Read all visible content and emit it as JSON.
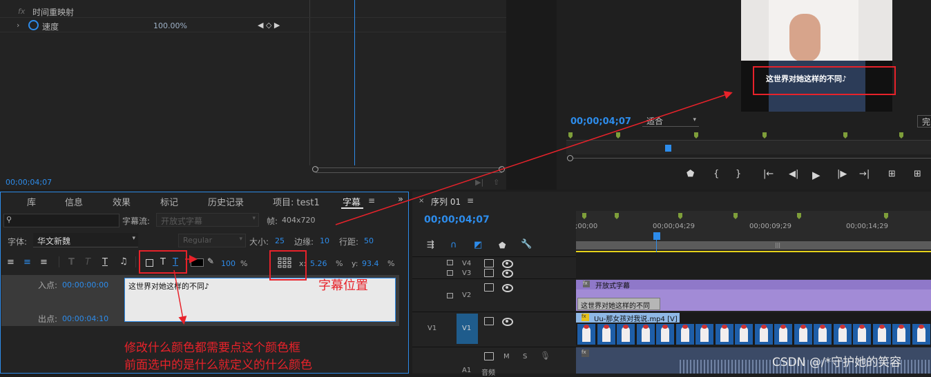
{
  "effect_controls": {
    "time_remap": "时间重映射",
    "speed_label": "速度",
    "speed_value": "100.00%",
    "timecode": "00;00;04;07"
  },
  "program_monitor": {
    "subtitle_text": "这世界对她这样的不同♪",
    "timecode": "00;00;04;07",
    "fit": "适合",
    "quality": "完"
  },
  "tabs": [
    "库",
    "信息",
    "效果",
    "标记",
    "历史记录",
    "项目: test1",
    "字幕"
  ],
  "caption_panel": {
    "search_placeholder": "",
    "stream_label": "字幕流:",
    "stream_value": "开放式字幕",
    "frame_label": "帧:",
    "frame_value": "404x720",
    "font_label": "字体:",
    "font_value": "华文新魏",
    "style_value": "Regular",
    "size_label": "大小:",
    "size_value": "25",
    "edge_label": "边缘:",
    "edge_value": "10",
    "linespace_label": "行距:",
    "linespace_value": "50",
    "opacity_value": "100",
    "percent": "%",
    "x_label": "x:",
    "x_value": "5.26",
    "y_label": "y:",
    "y_value": "93.4",
    "in_label": "入点:",
    "in_value": "00:00:00:00",
    "out_label": "出点:",
    "out_value": "00:00:04:10",
    "caption_text": "这世界对她这样的不同♪"
  },
  "sequence": {
    "title": "序列 01",
    "timecode": "00;00;04;07",
    "ruler": [
      ";00;00",
      "00;00;04;29",
      "00;00;09;29",
      "00;00;14;29"
    ],
    "tracks": {
      "v4": "V4",
      "v3": "V3",
      "v2": "V2",
      "v1": "V1",
      "a1": "A1"
    },
    "caption_clip_label": "开放式字幕",
    "caption_clip_text": "这世界对她这样的不同",
    "video_clip_label": "Uu-那女孩对我说.mp4 [V]",
    "audio_label": "音频",
    "m_label": "M",
    "s_label": "S"
  },
  "annotations": {
    "position_note": "字幕位置",
    "color_note_line1": "修改什么颜色都需要点这个颜色框",
    "color_note_line2": "前面选中的是什么就定义的什么颜色"
  },
  "watermark": "CSDN @/*守护她的笑容"
}
